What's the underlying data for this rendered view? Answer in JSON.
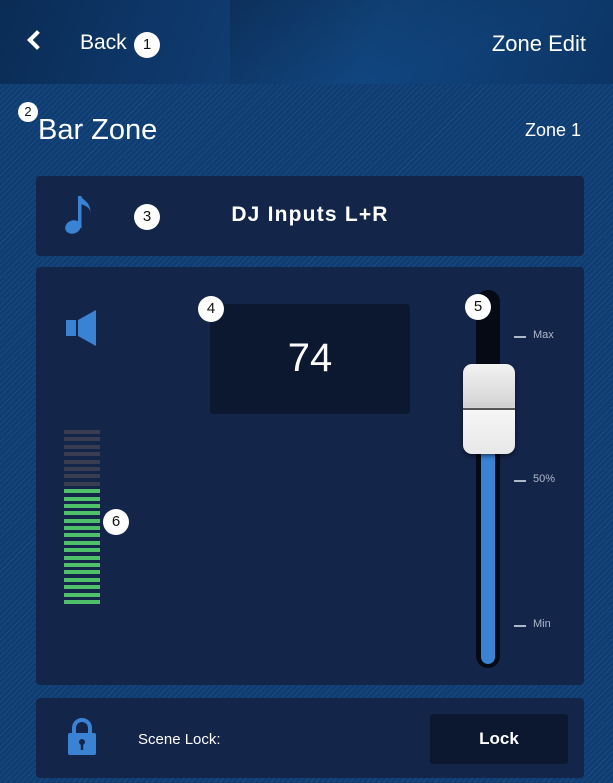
{
  "header": {
    "back_label": "Back",
    "title": "Zone Edit",
    "back_icon": "chevron-left-icon"
  },
  "zone": {
    "name": "Bar Zone",
    "number_label": "Zone 1"
  },
  "source": {
    "label": "DJ Inputs L+R",
    "icon": "music-note-icon"
  },
  "volume": {
    "value": "74",
    "icon": "speaker-icon",
    "slider_level_percent": 74,
    "scale_labels": {
      "max": "Max",
      "mid": "50%",
      "min": "Min"
    }
  },
  "meter": {
    "segments_total": 24,
    "segments_active": 16,
    "active_color": "#4fc06a",
    "inactive_color": "#3a3d52"
  },
  "scene_lock": {
    "label": "Scene Lock:",
    "button_label": "Lock",
    "icon": "lock-icon"
  },
  "annotations": [
    "1",
    "2",
    "3",
    "4",
    "5",
    "6"
  ],
  "colors": {
    "background": "#0e3d73",
    "panel": "#14254a",
    "accent": "#3a82d4",
    "value_box": "#0c1830"
  }
}
